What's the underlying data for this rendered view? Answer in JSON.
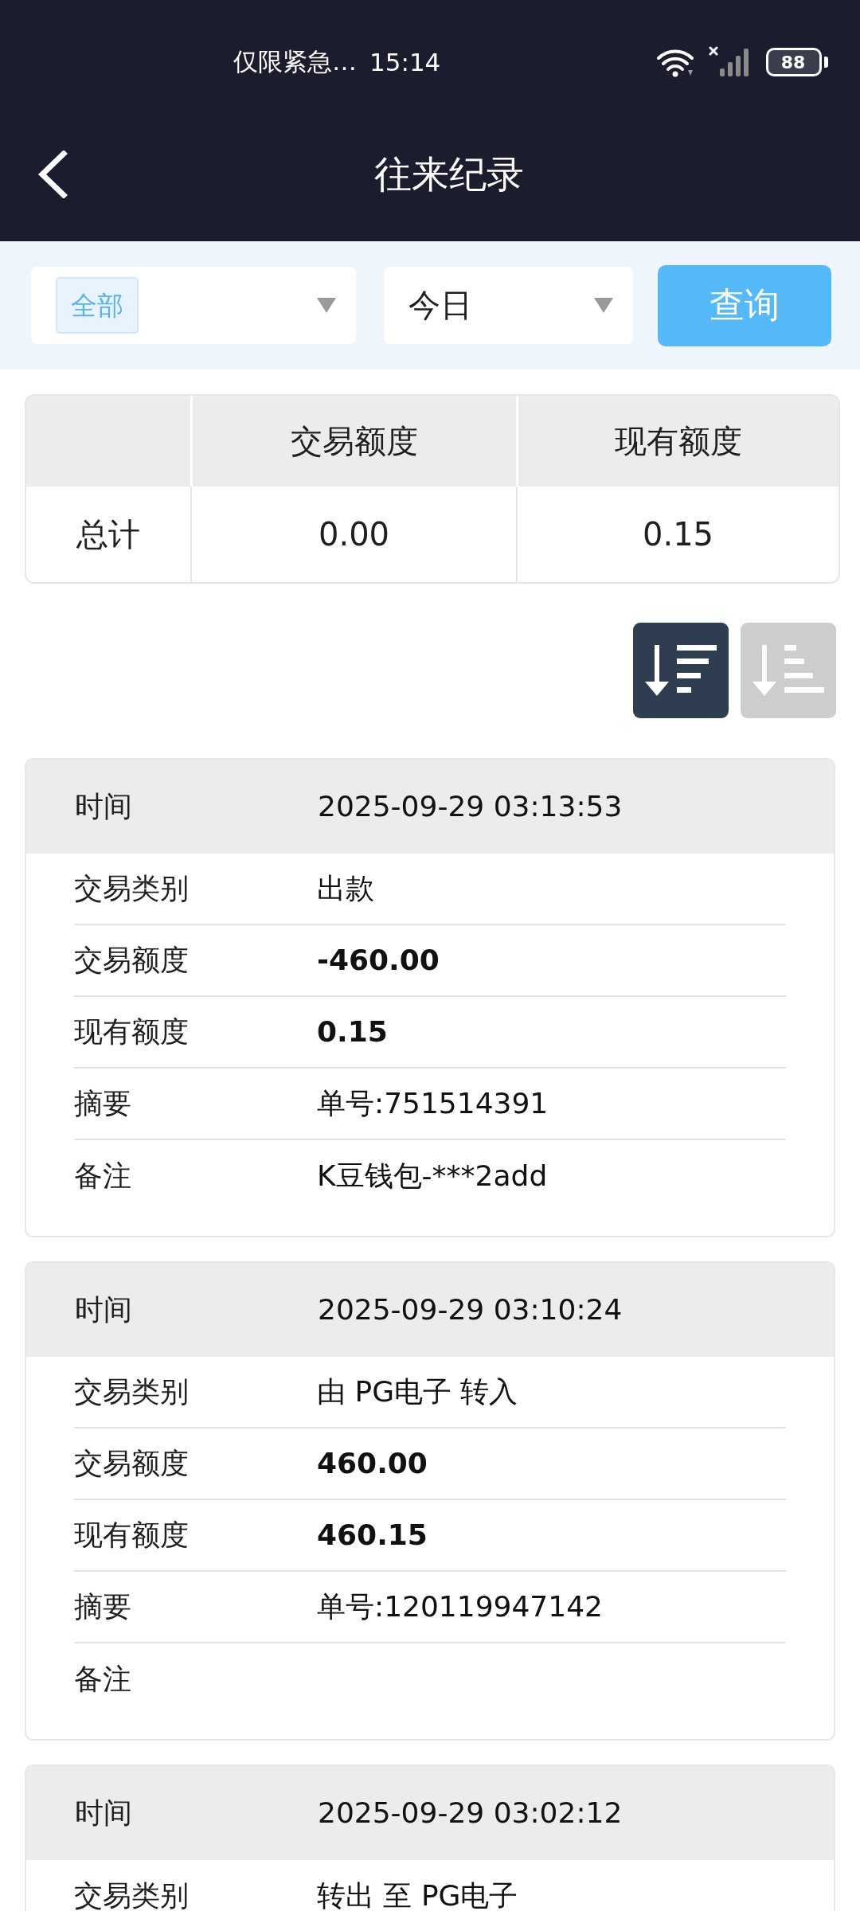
{
  "status_bar": {
    "notice": "仅限紧急…",
    "time": "15:14",
    "battery": "88"
  },
  "header": {
    "title": "往来纪录"
  },
  "filters": {
    "type_select": {
      "tag": "全部"
    },
    "date_select": {
      "value": "今日"
    },
    "query_button": "查询"
  },
  "summary": {
    "columns": [
      "交易额度",
      "现有额度"
    ],
    "rows": [
      {
        "label": "总计",
        "values": [
          "0.00",
          "0.15"
        ]
      }
    ]
  },
  "sort_buttons": [
    {
      "kind": "descending",
      "selected": true
    },
    {
      "kind": "ascending",
      "selected": false
    }
  ],
  "records": [
    {
      "time_label": "时间",
      "time": "2025-09-29 03:13:53",
      "fields": [
        {
          "kind": "text",
          "label": "交易类别",
          "value": "出款"
        },
        {
          "kind": "amount",
          "label": "交易额度",
          "value": "-460.00"
        },
        {
          "kind": "amount",
          "label": "现有额度",
          "value": "0.15"
        },
        {
          "kind": "text",
          "label": "摘要",
          "value": "单号:751514391"
        },
        {
          "kind": "text",
          "label": "备注",
          "value": "K豆钱包-***2add"
        }
      ]
    },
    {
      "time_label": "时间",
      "time": "2025-09-29 03:10:24",
      "fields": [
        {
          "kind": "text",
          "label": "交易类别",
          "value": "由 PG电子 转入"
        },
        {
          "kind": "amount",
          "label": "交易额度",
          "value": "460.00"
        },
        {
          "kind": "amount",
          "label": "现有额度",
          "value": "460.15"
        },
        {
          "kind": "text",
          "label": "摘要",
          "value": "单号:120119947142"
        },
        {
          "kind": "text",
          "label": "备注"
        }
      ]
    },
    {
      "time_label": "时间",
      "time": "2025-09-29 03:02:12",
      "fields": [
        {
          "kind": "text",
          "label": "交易类别",
          "value": "转出 至 PG电子"
        }
      ]
    }
  ]
}
